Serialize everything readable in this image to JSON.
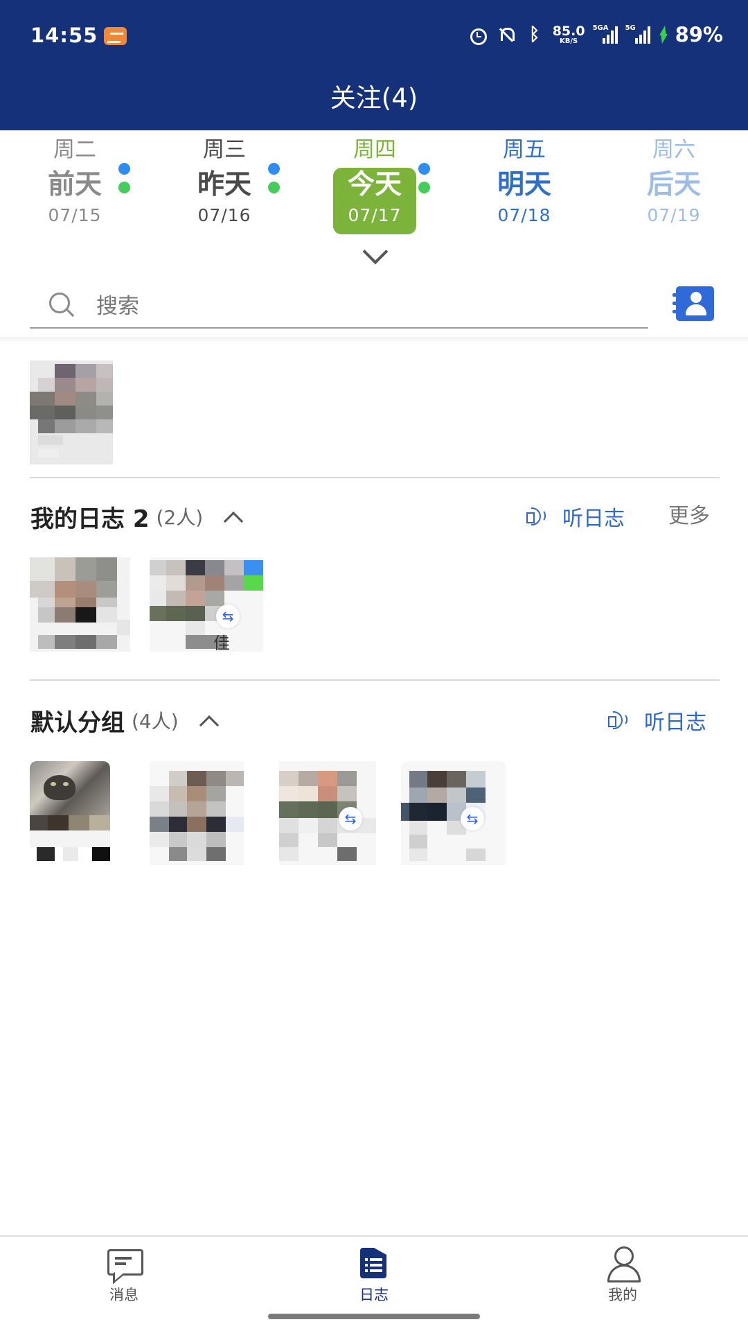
{
  "status_bar": {
    "time": "14:55",
    "speed_value": "85.0",
    "speed_unit": "KB/S",
    "network1": "5GA",
    "network2": "5G",
    "battery": "89%",
    "icons": [
      "app-icon",
      "alarm-icon",
      "mute-icon",
      "bluetooth-icon",
      "signal-icon",
      "charging-icon"
    ]
  },
  "header": {
    "title": "关注(4)"
  },
  "days": [
    {
      "weekday": "周二",
      "name": "前天",
      "date": "07/15",
      "color": "#8a8a8a",
      "dots": [
        "blue",
        "green"
      ]
    },
    {
      "weekday": "周三",
      "name": "昨天",
      "date": "07/16",
      "color": "#4a4a4a",
      "dots": [
        "blue",
        "green"
      ]
    },
    {
      "weekday": "周四",
      "name": "今天",
      "date": "07/17",
      "color": "#7cb33b",
      "selected": true,
      "dots": [
        "blue",
        "green"
      ]
    },
    {
      "weekday": "周五",
      "name": "明天",
      "date": "07/18",
      "color": "#2f6fc7"
    },
    {
      "weekday": "周六",
      "name": "后天",
      "date": "07/19",
      "color": "#9dbde6"
    }
  ],
  "search": {
    "placeholder": "搜索",
    "value": ""
  },
  "groups": [
    {
      "name": "我的日志 2",
      "count": "(2人)",
      "listen_label": "听日志",
      "more_label": "更多"
    },
    {
      "name": "默认分组",
      "count": "(4人)",
      "listen_label": "听日志"
    }
  ],
  "members_visible_text": {
    "my_log_second": "佳"
  },
  "bottom_nav": {
    "items": [
      {
        "label": "消息",
        "icon": "message-icon"
      },
      {
        "label": "日志",
        "icon": "log-list-icon",
        "active": true
      },
      {
        "label": "我的",
        "icon": "user-icon"
      }
    ]
  },
  "colors": {
    "header_bg": "#15317a",
    "accent_green": "#7cb33b",
    "link_blue": "#2f68c7"
  }
}
